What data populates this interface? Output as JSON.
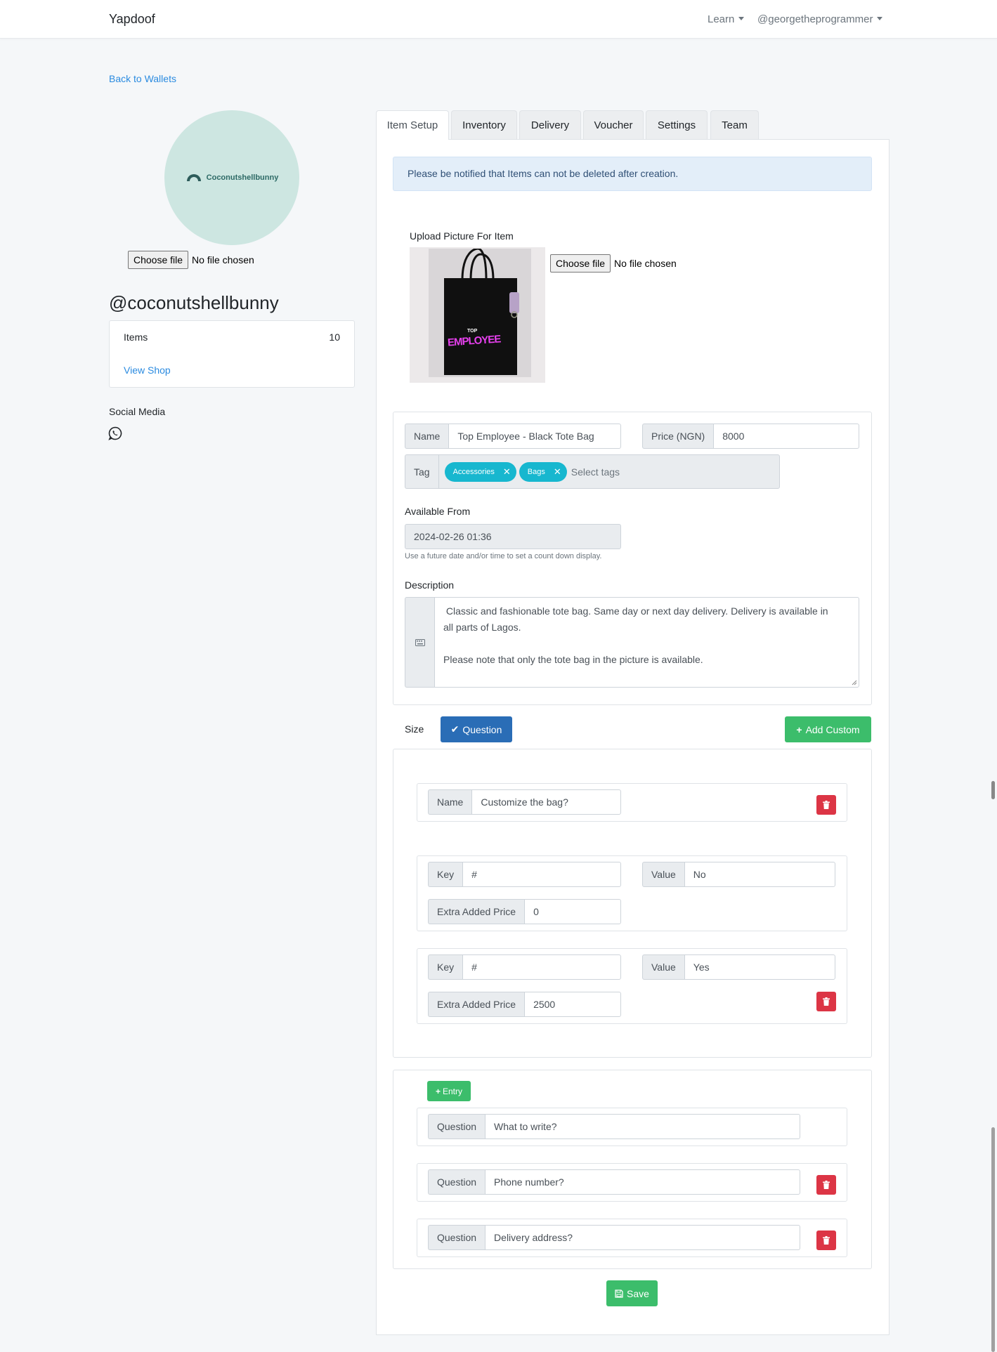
{
  "navbar": {
    "brand": "Yapdoof",
    "learn_label": "Learn",
    "user_label": "@georgetheprogrammer"
  },
  "sidebar": {
    "back_link": "Back to Wallets",
    "avatar_text": "Coconutshellbunny",
    "file_button": "Choose file",
    "file_status": "No file chosen",
    "handle": "@coconutshellbunny",
    "items_label": "Items",
    "items_count": "10",
    "view_shop": "View Shop",
    "social_label": "Social Media",
    "social_icon": "whatsapp-icon"
  },
  "tabs": [
    {
      "label": "Item Setup",
      "active": true
    },
    {
      "label": "Inventory",
      "active": false
    },
    {
      "label": "Delivery",
      "active": false
    },
    {
      "label": "Voucher",
      "active": false
    },
    {
      "label": "Settings",
      "active": false
    },
    {
      "label": "Team",
      "active": false
    }
  ],
  "alert": "Please be notified that Items can not be deleted after creation.",
  "upload": {
    "label": "Upload Picture For Item",
    "file_button": "Choose file",
    "file_status": "No file chosen",
    "bag_text_top": "TOP",
    "bag_text_main": "EMPLOYEE"
  },
  "item": {
    "name_label": "Name",
    "name_value": "Top Employee - Black Tote Bag",
    "price_label": "Price (NGN)",
    "price_value": "8000",
    "tag_label": "Tag",
    "tags": [
      "Accessories",
      "Bags"
    ],
    "tag_placeholder": "Select tags",
    "available_label": "Available From",
    "available_value": "2024-02-26 01:36",
    "available_help": "Use a future date and/or time to set a count down display.",
    "description_label": "Description",
    "description_value": " Classic and fashionable tote bag. Same day or next day delivery. Delivery is available in\nall parts of Lagos.\n\nPlease note that only the tote bag in the picture is available."
  },
  "options": {
    "size_label": "Size",
    "question_button": "Question",
    "add_custom_button": "Add Custom",
    "custom": {
      "name_label": "Name",
      "name_value": "Customize the bag?",
      "entries": [
        {
          "key_label": "Key",
          "key_value": "#",
          "value_label": "Value",
          "value_value": "No",
          "price_label": "Extra Added Price",
          "price_value": "0"
        },
        {
          "key_label": "Key",
          "key_value": "#",
          "value_label": "Value",
          "value_value": "Yes",
          "price_label": "Extra Added Price",
          "price_value": "2500"
        }
      ]
    }
  },
  "questions": {
    "entry_button": "Entry",
    "items": [
      {
        "label": "Question",
        "value": "What to write?"
      },
      {
        "label": "Question",
        "value": "Phone number?"
      },
      {
        "label": "Question",
        "value": "Delivery address?"
      }
    ]
  },
  "save_button": "Save",
  "colors": {
    "link": "#2b8be0",
    "green": "#3cbd6b",
    "blue": "#2a6db6",
    "red": "#dc3545",
    "chip": "#17b7cf"
  }
}
